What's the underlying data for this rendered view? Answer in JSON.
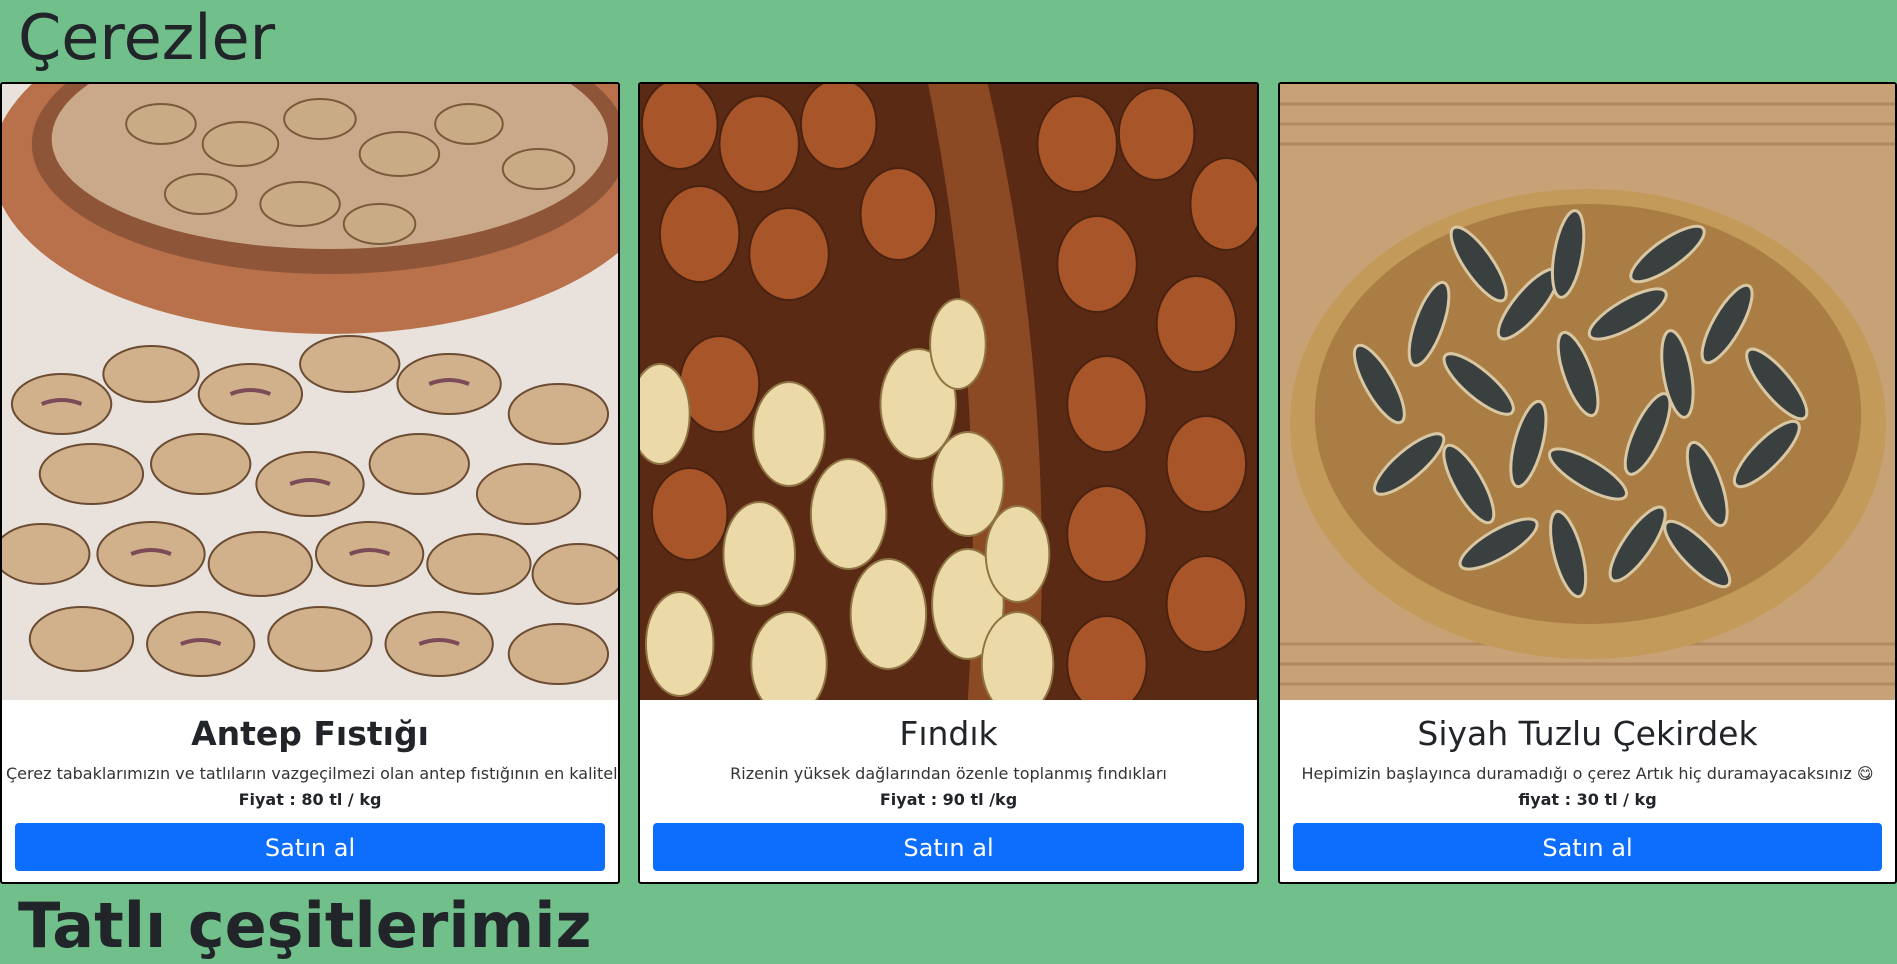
{
  "section": {
    "title": "Çerezler"
  },
  "next_section": {
    "title": "Tatlı çeşitlerimiz"
  },
  "products": [
    {
      "name": "Antep Fıstığı",
      "description": "Çerez tabaklarımızın ve tatlıların vazgeçilmezi olan antep fıstığının en kalitelisi",
      "price": "Fiyat : 80 tl / kg",
      "button": "Satın al",
      "image_icon": "pistachio-image"
    },
    {
      "name": "Fındık",
      "description": "Rizenin yüksek dağlarından özenle toplanmış fındıkları",
      "price": "Fiyat : 90 tl /kg",
      "button": "Satın al",
      "image_icon": "hazelnut-image"
    },
    {
      "name": "Siyah Tuzlu Çekirdek",
      "description": "Hepimizin başlayınca duramadığı o çerez Artık hiç duramayacaksınız 😋",
      "price": "fiyat : 30 tl / kg",
      "button": "Satın al",
      "image_icon": "sunflower-seeds-image"
    }
  ],
  "colors": {
    "background": "#71c08b",
    "button": "#0d6efd"
  }
}
